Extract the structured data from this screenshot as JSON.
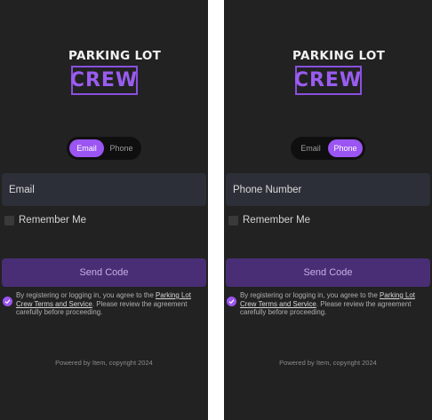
{
  "brand": {
    "logo_top": "PARKING LOT",
    "logo_bottom": "CREW"
  },
  "toggle": {
    "email_label": "Email",
    "phone_label": "Phone"
  },
  "left_screen": {
    "selected_tab": "Email",
    "field_placeholder": "Email"
  },
  "right_screen": {
    "selected_tab": "Phone",
    "field_placeholder": "Phone Number"
  },
  "remember_me": {
    "label": "Remember Me",
    "checked": false
  },
  "send_button": {
    "label": "Send Code"
  },
  "agreement": {
    "checked": true,
    "text_before": "By registering or logging in, you agree to the ",
    "link_text": "Parking Lot Crew Terms and Service",
    "text_after": ". Please review the agreement carefully before proceeding."
  },
  "footer": {
    "text": "Powered by Item, copyright 2024"
  },
  "colors": {
    "background": "#222222",
    "accent": "#9b55f2",
    "button": "#4a2e75",
    "input": "#2c2f38"
  },
  "icons": {
    "agree_check": "checkmark-circle-icon",
    "remember_box": "checkbox-icon"
  }
}
